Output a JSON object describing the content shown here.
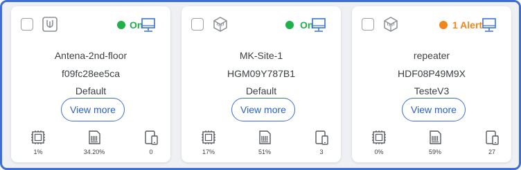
{
  "colors": {
    "on": "#22b04b",
    "alert": "#f0861c",
    "accent": "#3b6fd4"
  },
  "cards": [
    {
      "device_icon": "antenna-device-icon",
      "status": {
        "label": "On",
        "color": "#22b04b"
      },
      "name": "Antena-2nd-floor",
      "serial": "f09fc28ee5ca",
      "group": "Default",
      "view_more": "View more",
      "metrics": {
        "cpu": "1%",
        "memory": "34.20%",
        "devices": "0"
      }
    },
    {
      "device_icon": "router-device-icon",
      "status": {
        "label": "On",
        "color": "#22b04b"
      },
      "name": "MK-Site-1",
      "serial": "HGM09Y787B1",
      "group": "Default",
      "view_more": "View more",
      "metrics": {
        "cpu": "17%",
        "memory": "51%",
        "devices": "3"
      }
    },
    {
      "device_icon": "router-device-icon",
      "status": {
        "label": "1 Alert",
        "color": "#f0861c"
      },
      "name": "repeater",
      "serial": "HDF08P49M9X",
      "group": "TesteV3",
      "view_more": "View more",
      "metrics": {
        "cpu": "0%",
        "memory": "59%",
        "devices": "27"
      }
    }
  ]
}
